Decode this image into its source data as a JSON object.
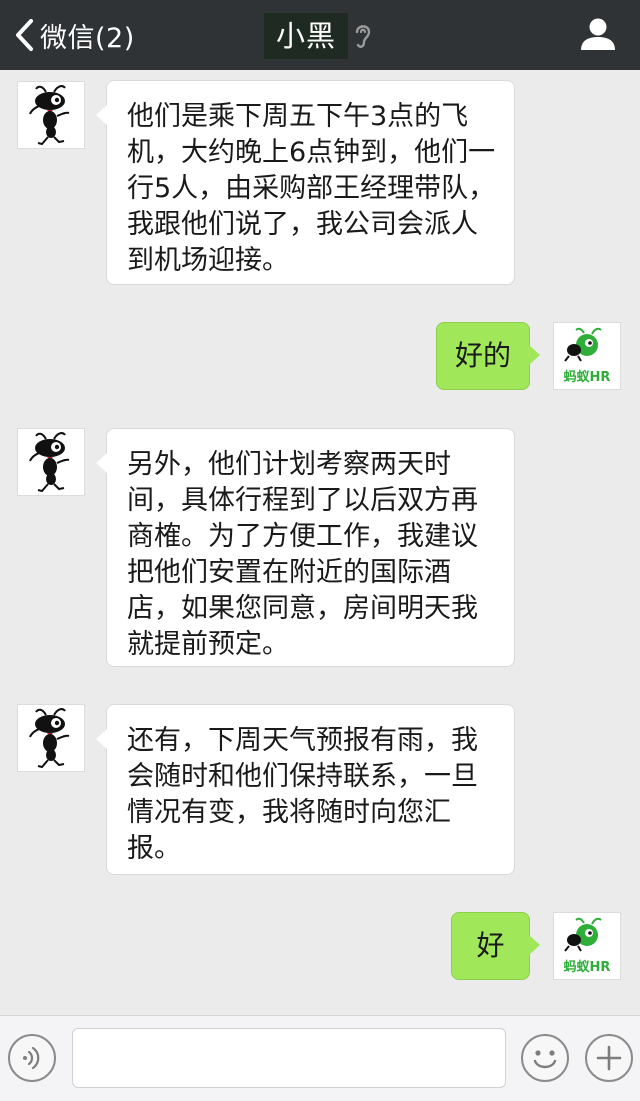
{
  "header": {
    "back_label": "微信(2)",
    "title": "小黑"
  },
  "messages": [
    {
      "side": "in",
      "text": "他们是乘下周五下午3点的飞机，大约晚上6点钟到，他们一行5人，由采购部王经理带队，我跟他们说了，我公司会派人到机场迎接。"
    },
    {
      "side": "out",
      "text": "好的",
      "avatar_label": "蚂蚁HR"
    },
    {
      "side": "in",
      "text": "另外，他们计划考察两天时间，具体行程到了以后双方再商榷。为了方便工作，我建议把他们安置在附近的国际酒店，如果您同意，房间明天我就提前预定。"
    },
    {
      "side": "in",
      "text": "还有，下周天气预报有雨，我会随时和他们保持联系，一旦情况有变，我将随时向您汇报。"
    },
    {
      "side": "out",
      "text": "好",
      "avatar_label": "蚂蚁HR"
    }
  ],
  "input": {
    "value": ""
  },
  "colors": {
    "header_bg": "#303336",
    "chat_bg": "#ebebeb",
    "out_bubble": "#a0e75a",
    "in_bubble": "#ffffff",
    "brand_green": "#2fae3a"
  }
}
